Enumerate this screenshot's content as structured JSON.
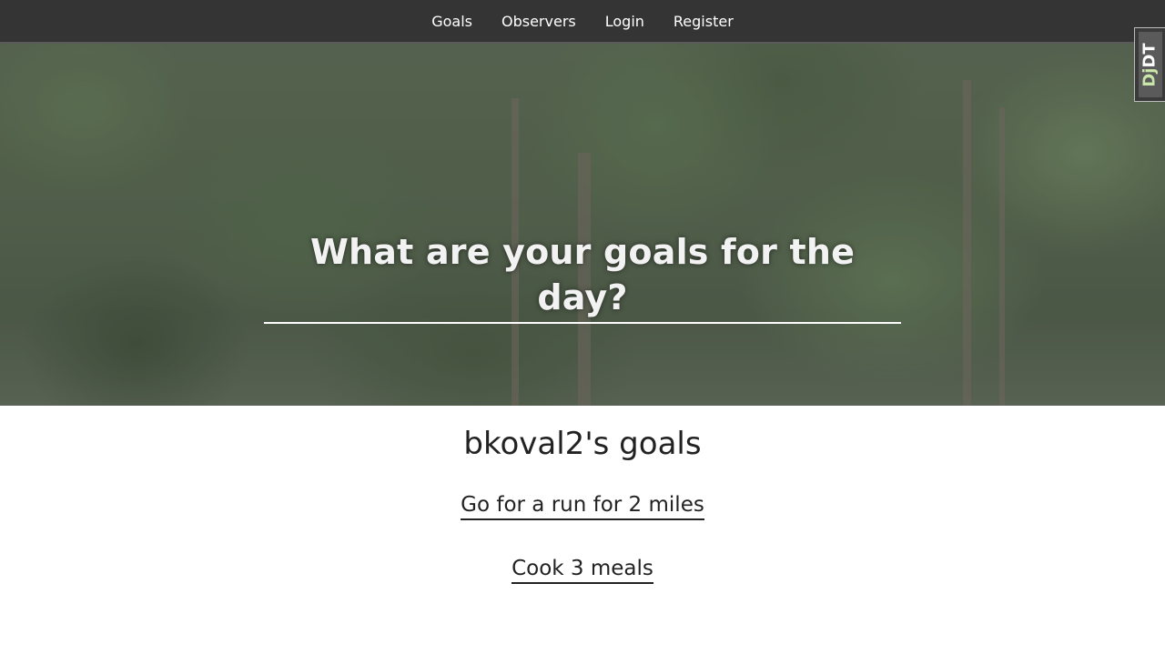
{
  "nav": {
    "items": [
      {
        "label": "Goals"
      },
      {
        "label": "Observers"
      },
      {
        "label": "Login"
      },
      {
        "label": "Register"
      }
    ]
  },
  "hero": {
    "heading": "What are your goals for the day?"
  },
  "debug_toolbar": {
    "label_dj": "Dj",
    "label_dt": "DT"
  },
  "main": {
    "title": "bkoval2's goals",
    "goals": [
      {
        "text": "Go for a run for 2 miles"
      },
      {
        "text": "Cook 3 meals"
      }
    ]
  }
}
